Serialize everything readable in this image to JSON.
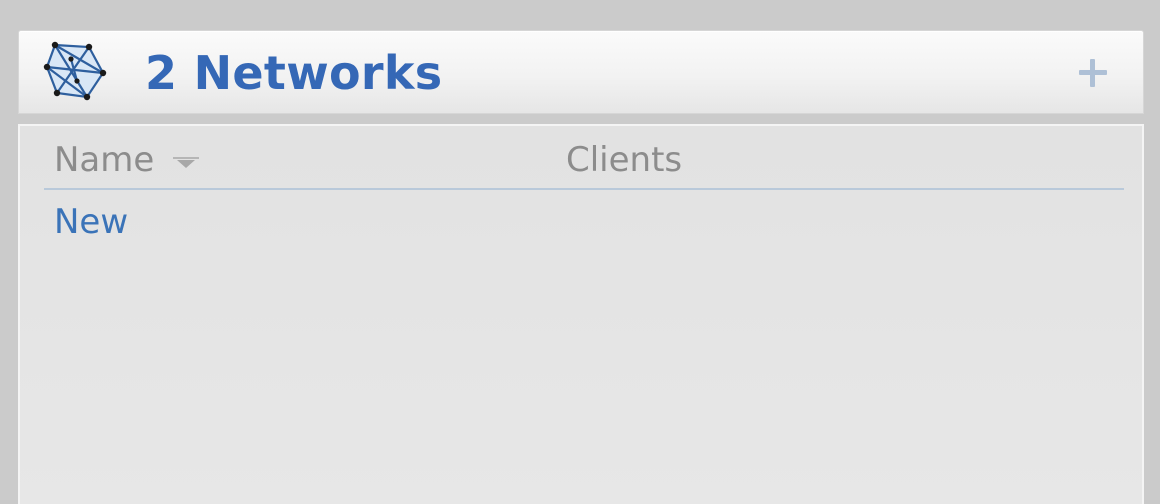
{
  "header": {
    "title": "2 Networks",
    "icon": "network-icon",
    "add_icon": "plus-icon",
    "title_color": "#3568b6"
  },
  "list": {
    "columns": [
      {
        "label": "Name",
        "sorted": "descending",
        "sort_icon": "sort-down-icon"
      },
      {
        "label": "Clients"
      }
    ],
    "rows": [
      {
        "name": "New",
        "clients": ""
      }
    ],
    "link_color": "#3a73b8"
  }
}
